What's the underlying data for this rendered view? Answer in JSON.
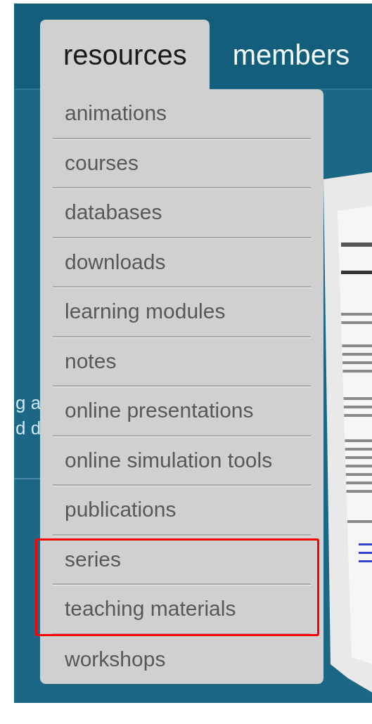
{
  "nav": {
    "tabs": [
      {
        "label": "resources",
        "selected": true
      },
      {
        "label": "members",
        "selected": false
      }
    ]
  },
  "background_text": [
    "g a",
    "d d"
  ],
  "menu": {
    "items": [
      {
        "label": "animations",
        "highlighted": false
      },
      {
        "label": "courses",
        "highlighted": false
      },
      {
        "label": "databases",
        "highlighted": false
      },
      {
        "label": "downloads",
        "highlighted": false
      },
      {
        "label": "learning modules",
        "highlighted": false
      },
      {
        "label": "notes",
        "highlighted": false
      },
      {
        "label": "online presentations",
        "highlighted": false
      },
      {
        "label": "online simulation tools",
        "highlighted": false
      },
      {
        "label": "publications",
        "highlighted": false
      },
      {
        "label": "series",
        "highlighted": true
      },
      {
        "label": "teaching materials",
        "highlighted": true
      },
      {
        "label": "workshops",
        "highlighted": false
      }
    ]
  }
}
